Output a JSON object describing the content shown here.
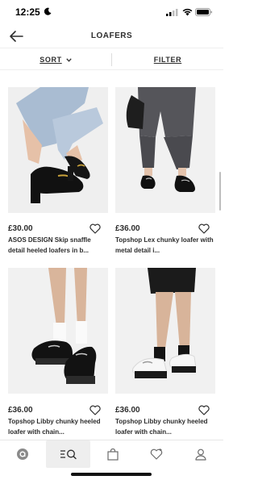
{
  "status_bar": {
    "time": "12:25"
  },
  "header": {
    "title": "LOAFERS"
  },
  "controls": {
    "sort_label": "SORT",
    "filter_label": "FILTER"
  },
  "products": [
    {
      "price": "£30.00",
      "title": "ASOS DESIGN Skip snaffle detail heeled loafers in b..."
    },
    {
      "price": "£36.00",
      "title": "Topshop Lex chunky loafer with metal detail i..."
    },
    {
      "price": "£36.00",
      "title": "Topshop Libby chunky heeled loafer with chain..."
    },
    {
      "price": "£36.00",
      "title": "Topshop Libby chunky heeled loafer with chain..."
    }
  ],
  "tabs": [
    {
      "icon": "asos-logo-icon"
    },
    {
      "icon": "search-icon"
    },
    {
      "icon": "bag-icon"
    },
    {
      "icon": "saved-items-icon"
    },
    {
      "icon": "account-icon"
    }
  ],
  "colors": {
    "text": "#2d2d2d",
    "divider": "#eeeeee",
    "active_tab": "#eeeeee"
  }
}
